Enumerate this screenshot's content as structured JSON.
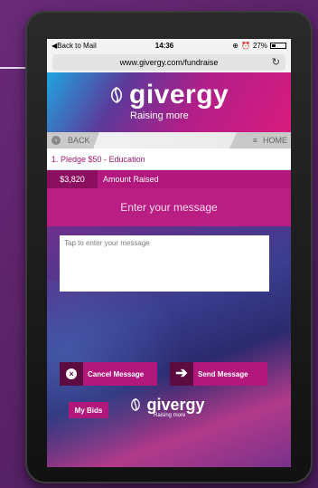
{
  "status": {
    "back_label": "Back to Mail",
    "time": "14:36",
    "battery": "27%",
    "battery_level": 0.27
  },
  "browser": {
    "url": "www.givergy.com/fundraise"
  },
  "brand": {
    "name": "givergy",
    "tagline": "Raising more",
    "primary_color": "#b2177c",
    "dark_color": "#5c0b40"
  },
  "nav": {
    "back": "BACK",
    "home": "HOME"
  },
  "pledge": {
    "title": "1. Pledge $50 - Education",
    "amount": "$3,820",
    "amount_label": "Amount Raised"
  },
  "message": {
    "header": "Enter your message",
    "placeholder": "Tap to enter your message"
  },
  "actions": {
    "cancel": "Cancel Message",
    "send": "Send Message",
    "my_bids": "My Bids"
  }
}
